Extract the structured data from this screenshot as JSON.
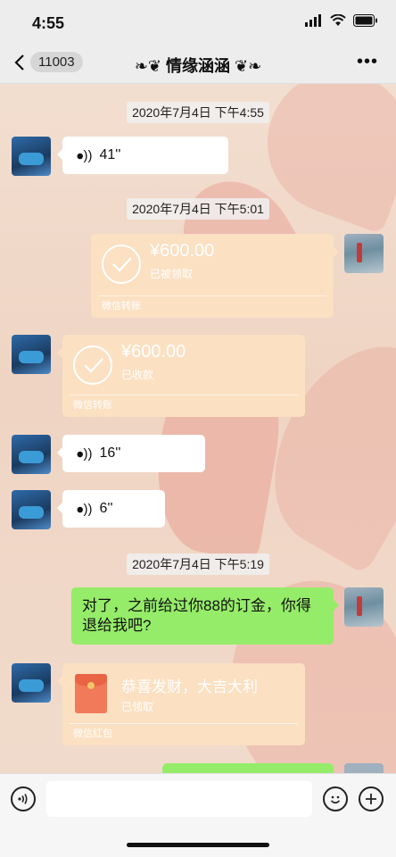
{
  "status": {
    "time": "4:55"
  },
  "nav": {
    "back_count": "11003",
    "title": "情缘涵涵",
    "title_decor_left": "❧❦",
    "title_decor_right": "❦❧",
    "more": "•••"
  },
  "messages": {
    "ts1": "2020年7月4日 下午4:55",
    "voice1": "41''",
    "ts2": "2020年7月4日 下午5:01",
    "transfer1": {
      "amount": "¥600.00",
      "status": "已被领取",
      "footer": "微信转账"
    },
    "transfer2": {
      "amount": "¥600.00",
      "status": "已收款",
      "footer": "微信转账"
    },
    "voice2": "16''",
    "voice3": "6''",
    "ts3": "2020年7月4日 下午5:19",
    "text1": "对了，之前给过你88的订金，你得退给我吧?",
    "redpacket": {
      "title": "恭喜发财，大吉大利",
      "status": "已领取",
      "footer": "微信红包"
    }
  },
  "input": {
    "placeholder": ""
  },
  "colors": {
    "bubble_green": "#95ec69",
    "transfer_card": "#fbe0c2",
    "nav_bg": "#ededed"
  },
  "icons": [
    "back-chevron-icon",
    "more-icon",
    "voice-icon",
    "check-icon",
    "red-envelope-icon",
    "emoji-icon",
    "plus-icon",
    "voice-input-icon",
    "signal-icon",
    "wifi-icon",
    "battery-icon"
  ]
}
